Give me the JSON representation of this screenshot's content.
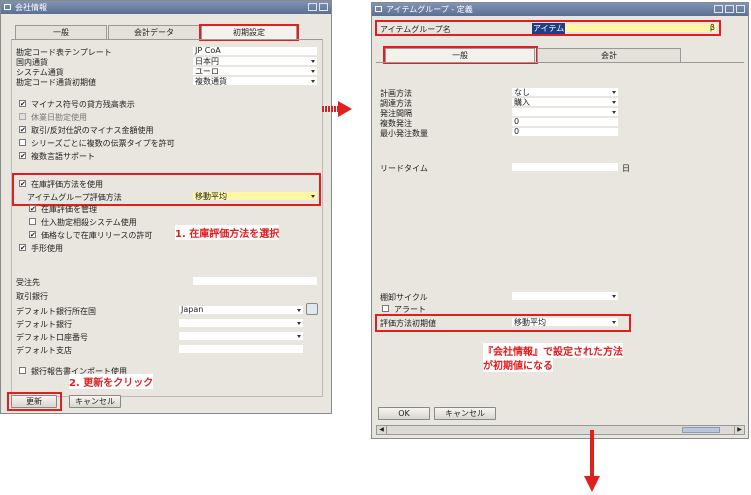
{
  "left": {
    "title": "会社情報",
    "tabs": [
      "一般",
      "会計データ",
      "初期設定"
    ],
    "rows1": [
      {
        "label": "勘定コード表テンプレート",
        "value": "JP CoA",
        "select": false
      },
      {
        "label": "国内通貨",
        "value": "日本円",
        "select": true
      },
      {
        "label": "システム通貨",
        "value": "ユーロ",
        "select": true
      },
      {
        "label": "勘定コード通貨初期値",
        "value": "複数通貨",
        "select": true
      }
    ],
    "checks1": [
      {
        "label": "マイナス符号の貸方残高表示",
        "checked": true,
        "disabled": false
      },
      {
        "label": "休業日勘定使用",
        "checked": false,
        "disabled": true
      },
      {
        "label": "取引/反対仕訳のマイナス金額使用",
        "checked": true,
        "disabled": false
      },
      {
        "label": "シリーズごとに複数の伝票タイプを許可",
        "checked": false,
        "disabled": false
      },
      {
        "label": "複数言語サポート",
        "checked": true,
        "disabled": false
      }
    ],
    "inventory_check": "在庫評価方法を使用",
    "item_group_valuation_label": "アイテムグループ評価方法",
    "item_group_valuation_value": "移動平均",
    "checks2": [
      {
        "label": "在庫評価を管理",
        "checked": true
      },
      {
        "label": "仕入勘定相殺システム使用",
        "checked": false
      },
      {
        "label": "価格なしで在庫リリースの許可",
        "checked": true
      }
    ],
    "manual_use": "手形使用",
    "receiver_label": "受注先",
    "bank_section": "取引銀行",
    "bank_rows": [
      {
        "label": "デフォルト銀行所在国",
        "value": "Japan",
        "select": true
      },
      {
        "label": "デフォルト銀行",
        "value": "",
        "select": true
      },
      {
        "label": "デフォルト口座番号",
        "value": "",
        "select": true
      },
      {
        "label": "デフォルト支店",
        "value": "",
        "select": false
      }
    ],
    "bank_report_check": "銀行報告書インポート使用",
    "update_button": "更新",
    "cancel_button": "キャンセル"
  },
  "right": {
    "title": "アイテムグループ - 定義",
    "group_name_label": "アイテムグループ名",
    "group_name_value": "アイテム",
    "group_name_suffix": "β",
    "tabs": [
      "一般",
      "会計"
    ],
    "rows": [
      {
        "label": "計画方法",
        "value": "なし",
        "select": true
      },
      {
        "label": "調達方法",
        "value": "購入",
        "select": true
      },
      {
        "label": "発注間隔",
        "value": "",
        "select": true
      },
      {
        "label": "複数発注",
        "value": "0",
        "select": false
      },
      {
        "label": "最小発注数量",
        "value": "0",
        "select": false
      }
    ],
    "lead_time_label": "リードタイム",
    "lead_time_unit": "日",
    "count_cycle_label": "棚卸サイクル",
    "alert_label": "アラート",
    "valuation_default_label": "評価方法初期値",
    "valuation_default_value": "移動平均",
    "ok_button": "OK",
    "cancel_button": "キャンセル"
  },
  "annotations": {
    "step1": "1. 在庫評価方法を選択",
    "step2": "2. 更新をクリック",
    "note_line1": "『会社情報』で設定された方法",
    "note_line2": "が初期値になる"
  },
  "colors": {
    "highlight_red": "#e02020",
    "title_blue": "#5b6f93",
    "selected_yellow": "#fff6a6"
  }
}
